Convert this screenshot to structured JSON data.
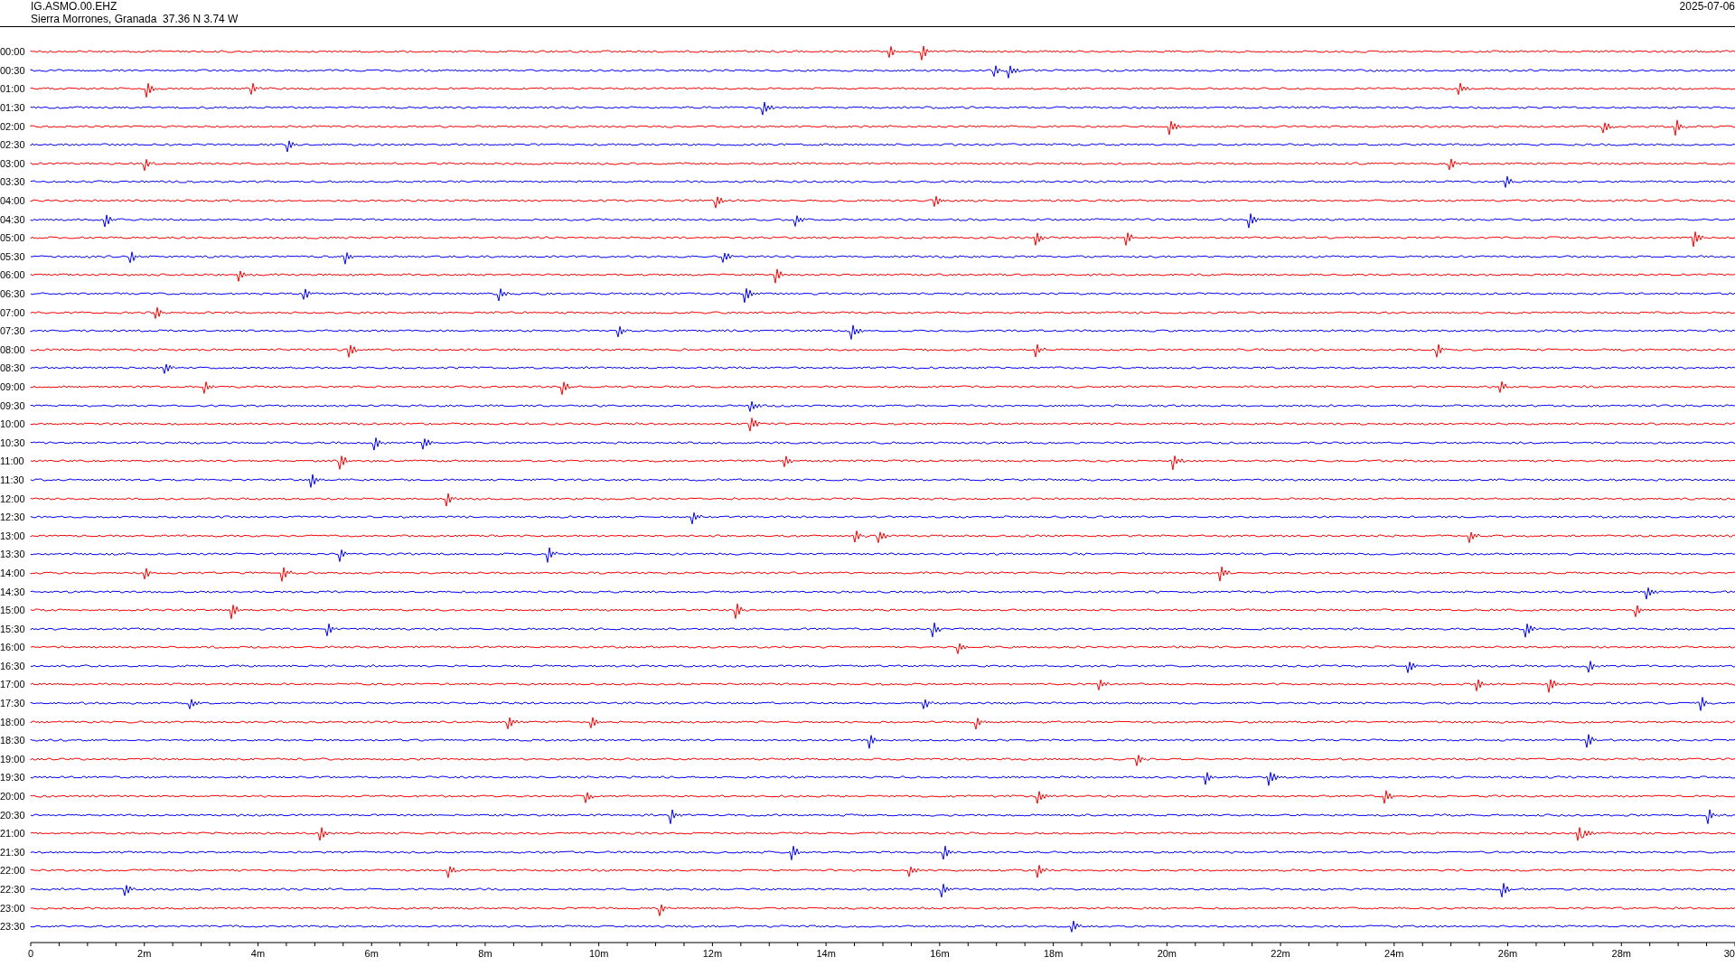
{
  "header": {
    "station": "IG.ASMO.00.EHZ",
    "location": "Sierra Morrones, Granada  37.36 N 3.74 W",
    "date": "2025-07-06"
  },
  "rows": [
    {
      "time": "00:00",
      "color": "#ff0000"
    },
    {
      "time": "00:30",
      "color": "#0000ff"
    },
    {
      "time": "01:00",
      "color": "#ff0000"
    },
    {
      "time": "01:30",
      "color": "#0000ff"
    },
    {
      "time": "02:00",
      "color": "#ff0000"
    },
    {
      "time": "02:30",
      "color": "#0000ff"
    },
    {
      "time": "03:00",
      "color": "#ff0000"
    },
    {
      "time": "03:30",
      "color": "#0000ff"
    },
    {
      "time": "04:00",
      "color": "#ff0000"
    },
    {
      "time": "04:30",
      "color": "#0000ff"
    },
    {
      "time": "05:00",
      "color": "#ff0000"
    },
    {
      "time": "05:30",
      "color": "#0000ff"
    },
    {
      "time": "06:00",
      "color": "#ff0000"
    },
    {
      "time": "06:30",
      "color": "#0000ff"
    },
    {
      "time": "07:00",
      "color": "#ff0000"
    },
    {
      "time": "07:30",
      "color": "#0000ff"
    },
    {
      "time": "08:00",
      "color": "#ff0000"
    },
    {
      "time": "08:30",
      "color": "#0000ff"
    },
    {
      "time": "09:00",
      "color": "#ff0000"
    },
    {
      "time": "09:30",
      "color": "#0000ff"
    },
    {
      "time": "10:00",
      "color": "#ff0000"
    },
    {
      "time": "10:30",
      "color": "#0000ff"
    },
    {
      "time": "11:00",
      "color": "#ff0000"
    },
    {
      "time": "11:30",
      "color": "#0000ff"
    },
    {
      "time": "12:00",
      "color": "#ff0000"
    },
    {
      "time": "12:30",
      "color": "#0000ff"
    },
    {
      "time": "13:00",
      "color": "#ff0000"
    },
    {
      "time": "13:30",
      "color": "#0000ff"
    },
    {
      "time": "14:00",
      "color": "#ff0000"
    },
    {
      "time": "14:30",
      "color": "#0000ff"
    },
    {
      "time": "15:00",
      "color": "#ff0000"
    },
    {
      "time": "15:30",
      "color": "#0000ff"
    },
    {
      "time": "16:00",
      "color": "#ff0000"
    },
    {
      "time": "16:30",
      "color": "#0000ff"
    },
    {
      "time": "17:00",
      "color": "#ff0000"
    },
    {
      "time": "17:30",
      "color": "#0000ff"
    },
    {
      "time": "18:00",
      "color": "#ff0000"
    },
    {
      "time": "18:30",
      "color": "#0000ff"
    },
    {
      "time": "19:00",
      "color": "#ff0000"
    },
    {
      "time": "19:30",
      "color": "#0000ff"
    },
    {
      "time": "20:00",
      "color": "#ff0000"
    },
    {
      "time": "20:30",
      "color": "#0000ff"
    },
    {
      "time": "21:00",
      "color": "#ff0000"
    },
    {
      "time": "21:30",
      "color": "#0000ff"
    },
    {
      "time": "22:00",
      "color": "#ff0000"
    },
    {
      "time": "22:30",
      "color": "#0000ff"
    },
    {
      "time": "23:00",
      "color": "#ff0000"
    },
    {
      "time": "23:30",
      "color": "#0000ff"
    }
  ],
  "axis": {
    "labels": [
      "0",
      "2m",
      "4m",
      "6m",
      "8m",
      "10m",
      "12m",
      "14m",
      "16m",
      "18m",
      "20m",
      "22m",
      "24m",
      "26m",
      "28m",
      "30"
    ]
  }
}
